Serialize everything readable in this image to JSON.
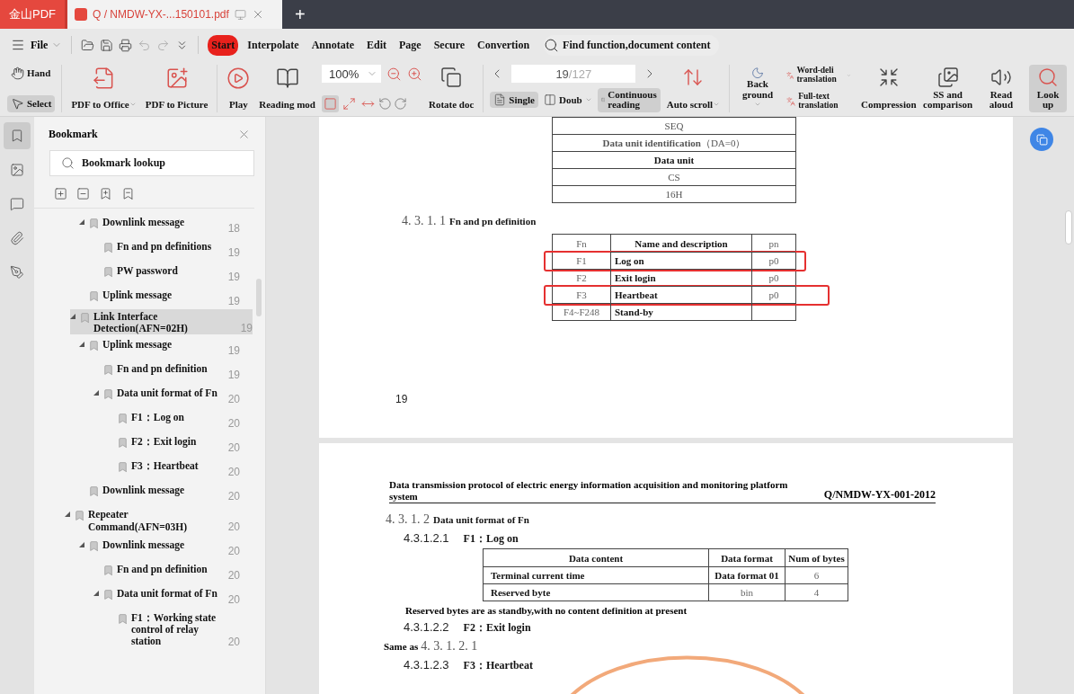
{
  "tab_bar": {
    "app": "金山PDF",
    "document": {
      "title": "Q / NMDW-YX-...150101.pdf",
      "selected": true
    },
    "new_tab": "+"
  },
  "menu": {
    "file": "File",
    "tabs": [
      {
        "label": "Start",
        "selected": true
      },
      {
        "label": "Interpolate",
        "selected": false
      },
      {
        "label": "Annotate",
        "selected": false
      },
      {
        "label": "Edit",
        "selected": false
      },
      {
        "label": "Page",
        "selected": false
      },
      {
        "label": "Secure",
        "selected": false
      },
      {
        "label": "Convertion",
        "selected": false
      }
    ],
    "search": {
      "placeholder": "Find function,document content"
    }
  },
  "ribbon": {
    "pointer_tools": [
      {
        "label": "Hand",
        "selected": false
      },
      {
        "label": "Select",
        "selected": true
      }
    ],
    "convert": [
      {
        "label": "PDF to Office",
        "caret": true
      },
      {
        "label": "PDF to Picture",
        "caret": false
      }
    ],
    "view": [
      {
        "label": "Play"
      },
      {
        "label": "Reading mod"
      }
    ],
    "zoom": {
      "value": "100%",
      "fit_modes": [
        {
          "selected": true
        },
        {
          "selected": false
        },
        {
          "selected": false
        }
      ]
    },
    "rotate": {
      "label": "Rotate doc"
    },
    "page_nav": {
      "current": "19",
      "total": "/127"
    },
    "layouts": [
      {
        "label": "Single",
        "selected": true,
        "caret": false
      },
      {
        "label": "Doub",
        "selected": false,
        "caret": true
      },
      {
        "label": "Continuous reading",
        "selected": true,
        "caret": false
      }
    ],
    "scroll": {
      "label": "Auto scroll",
      "caret": true
    },
    "background": {
      "label": "Back ground",
      "caret": true
    },
    "translation": [
      {
        "label": "Word-deli translation",
        "caret": true
      },
      {
        "label": "Full-text translation",
        "caret": false
      }
    ],
    "tools": [
      {
        "label": "Compression",
        "selected": false
      },
      {
        "label": "SS and comparison",
        "selected": false
      },
      {
        "label": "Read aloud",
        "selected": false
      },
      {
        "label": "Look up",
        "selected": true
      }
    ]
  },
  "side_rail": [
    {
      "selected": true
    },
    {
      "selected": false
    },
    {
      "selected": false
    },
    {
      "selected": false
    },
    {
      "selected": false
    }
  ],
  "bookmarks": {
    "title": "Bookmark",
    "search": {
      "placeholder": "Bookmark lookup"
    },
    "scrolled_branch": [
      {
        "label": "Downlink message",
        "page": "18",
        "selected": false,
        "expanded": true,
        "children": [
          {
            "label": "Fn and pn definitions",
            "page": "19",
            "selected": false
          },
          {
            "label": "PW password",
            "page": "19",
            "selected": false
          }
        ]
      },
      {
        "label": "Uplink message",
        "page": "19",
        "selected": false
      }
    ],
    "items": [
      {
        "label": "Link Interface Detection(AFN=02H)",
        "page": "19",
        "selected": true,
        "expanded": true,
        "children": [
          {
            "label": "Uplink message",
            "page": "19",
            "selected": false,
            "expanded": true,
            "children": [
              {
                "label": "Fn and pn definition",
                "page": "19",
                "selected": false
              },
              {
                "label": "Data unit format of Fn",
                "page": "20",
                "selected": false,
                "expanded": true,
                "children": [
                  {
                    "label": "F1：Log on",
                    "page": "20",
                    "selected": false
                  },
                  {
                    "label": "F2：Exit login",
                    "page": "20",
                    "selected": false
                  },
                  {
                    "label": "F3：Heartbeat",
                    "page": "20",
                    "selected": false
                  }
                ]
              }
            ]
          },
          {
            "label": "Downlink message",
            "page": "20",
            "selected": false
          }
        ]
      },
      {
        "label": "Repeater Command(AFN=03H)",
        "page": "20",
        "selected": false,
        "expanded": true,
        "children": [
          {
            "label": "Downlink message",
            "page": "20",
            "selected": false,
            "expanded": true,
            "children": [
              {
                "label": "Fn and pn definition",
                "page": "20",
                "selected": false
              },
              {
                "label": "Data unit format of Fn",
                "page": "20",
                "selected": false,
                "expanded": true,
                "children": [
                  {
                    "label": "F1：Working state control of relay station",
                    "page": "20",
                    "selected": false
                  }
                ]
              }
            ]
          }
        ]
      }
    ]
  },
  "document": {
    "page_1": {
      "frame_table": [
        {
          "text": "SEQ",
          "bold": false
        },
        {
          "text": "**Data unit identification**（DA=0）",
          "bold": false
        },
        {
          "text": "Data unit",
          "bold": true
        },
        {
          "text": "CS",
          "bold": false
        },
        {
          "text": "16H",
          "bold": false
        }
      ],
      "section": {
        "number": "4. 3. 1. 1",
        "title": "Fn and pn definition"
      },
      "fn_table": {
        "columns": [
          "Fn",
          "Name and description",
          "pn"
        ],
        "rows": [
          {
            "fn": "F1",
            "name": "Log on",
            "pn": "p0",
            "annotated": true
          },
          {
            "fn": "F2",
            "name": "Exit login",
            "pn": "p0",
            "annotated": false
          },
          {
            "fn": "F3",
            "name": "Heartbeat",
            "pn": "p0",
            "annotated": true
          },
          {
            "fn": "F4~F248",
            "name": "Stand-by",
            "annotated": false
          }
        ]
      },
      "page_number": "19"
    },
    "page_2": {
      "header": {
        "title": "Data transmission protocol of electric energy information acquisition and monitoring platform system",
        "code": "Q/NMDW-YX-001-2012"
      },
      "blocks": [
        {
          "kind": "heading",
          "number": "4. 3. 1. 2",
          "title": "Data unit format of  Fn"
        },
        {
          "kind": "subheading",
          "number": "4.3.1.2.1",
          "title": "F1：Log on"
        },
        {
          "kind": "table",
          "columns": [
            "Data content",
            "Data format",
            "Num of bytes"
          ],
          "rows": [
            [
              "Terminal current time",
              "Data format 01",
              "6"
            ],
            [
              "Reserved byte",
              "bin",
              "4"
            ]
          ]
        },
        {
          "kind": "paragraph",
          "text": "Reserved bytes are as standby,with no content definition at present"
        },
        {
          "kind": "subheading",
          "number": "4.3.1.2.2",
          "title": "F2：Exit login"
        },
        {
          "kind": "reference",
          "text": "Same as",
          "ref": "4. 3. 1. 2. 1"
        },
        {
          "kind": "subheading",
          "number": "4.3.1.2.3",
          "title": "F3：Heartbeat"
        }
      ],
      "ink": [
        {
          "kind": "circle",
          "color": "#f2a97a"
        }
      ]
    }
  }
}
